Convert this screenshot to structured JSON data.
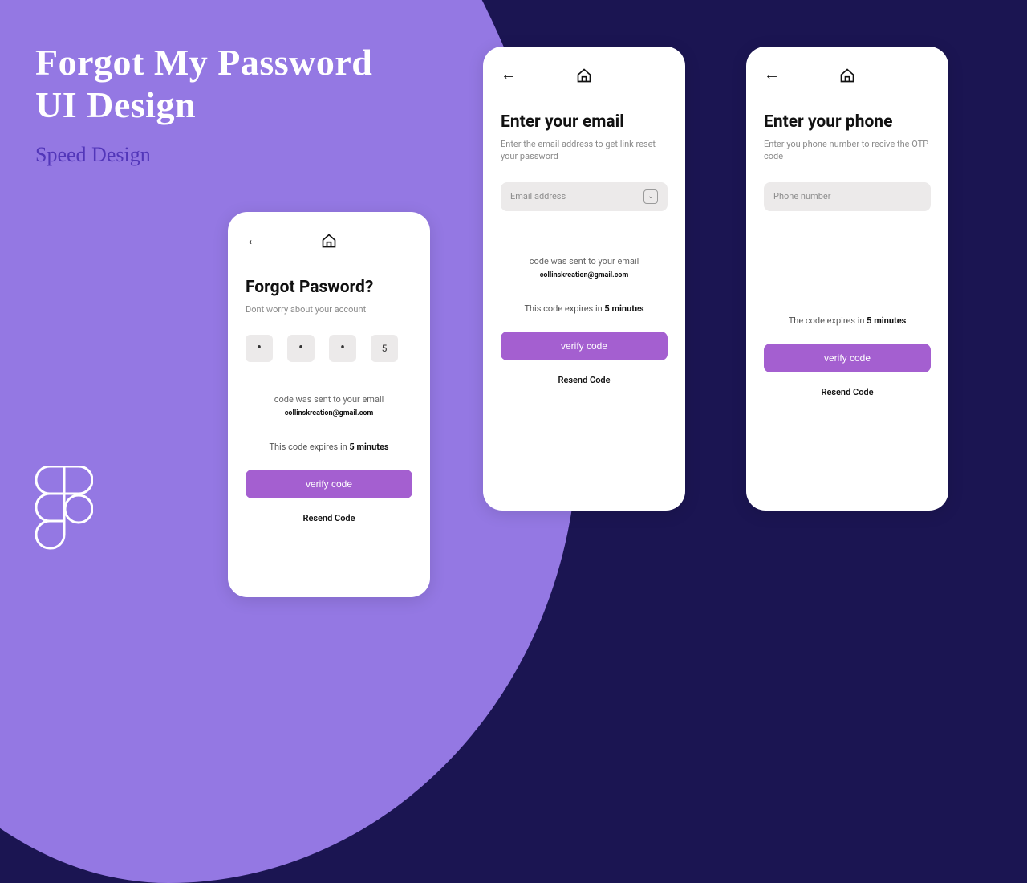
{
  "headline": {
    "line1": "Forgot My Password",
    "line2": "UI Design",
    "sub": "Speed Design"
  },
  "common": {
    "verify_btn": "verify code",
    "resend": "Resend Code",
    "expiry_prefix": "This code expires in ",
    "expiry_prefix_alt": "The code expires in ",
    "expiry_bold": "5 minutes",
    "sent_msg": "code was sent to your email",
    "sent_email": "collinskreation@gmail.com"
  },
  "phone1": {
    "title": "Forgot Pasword?",
    "desc": "Dont worry about your account",
    "otp": [
      "•",
      "•",
      "•",
      "5"
    ]
  },
  "phone2": {
    "title": "Enter your email",
    "desc": "Enter the email address to get link reset your password",
    "placeholder": "Email address"
  },
  "phone3": {
    "title": "Enter your phone",
    "desc": "Enter you phone number to recive the OTP code",
    "placeholder": "Phone  number"
  }
}
